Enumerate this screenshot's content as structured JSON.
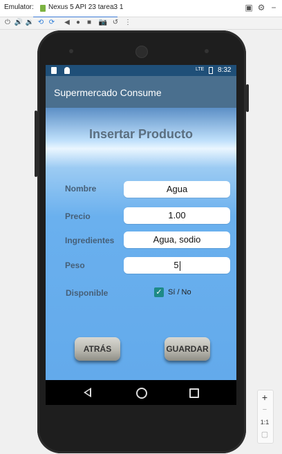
{
  "window": {
    "emulator_label": "Emulator:",
    "tab_label": "Nexus 5 API 23 tarea3 1",
    "tab_close": "×"
  },
  "toolbar": {
    "icons": [
      "power-icon",
      "volume-up-icon",
      "volume-down-icon",
      "rotate-left-icon",
      "rotate-right-icon",
      "back-icon",
      "home-icon",
      "overview-icon",
      "camera-icon",
      "replay-icon",
      "more-icon"
    ]
  },
  "status_bar": {
    "network": "LTE",
    "time": "8:32"
  },
  "app": {
    "title": "Supermercado Consume",
    "heading": "Insertar Producto",
    "form": {
      "nombre_label": "Nombre",
      "nombre_value": "Agua",
      "precio_label": "Precio",
      "precio_value": "1.00",
      "ingredientes_label": "Ingredientes",
      "ingredientes_value": "Agua, sodio",
      "peso_label": "Peso",
      "peso_value": "5",
      "disponible_label": "Disponible",
      "disponible_checkbox_label": "Sí / No",
      "disponible_checked": true
    },
    "buttons": {
      "back": "ATRÁS",
      "save": "GUARDAR"
    }
  },
  "zoom_panel": {
    "zoom_in": "+",
    "zoom_out": "−",
    "actual_size": "1:1"
  },
  "colors": {
    "appbar": "#4a6f8e",
    "status_bar": "#1f4f78",
    "checkbox": "#1e8a86",
    "background_blue": "#63aaeb"
  }
}
